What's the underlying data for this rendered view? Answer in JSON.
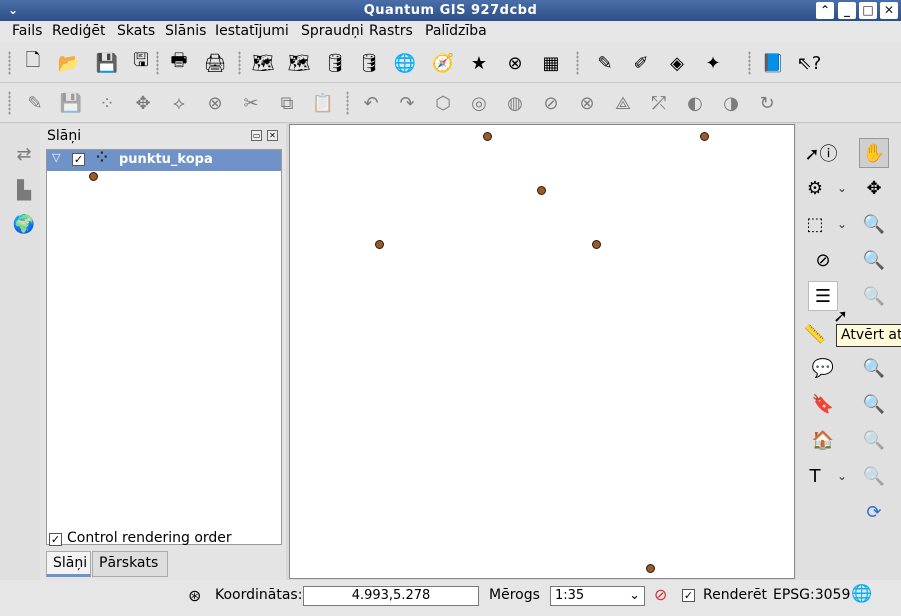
{
  "window": {
    "title": "Quantum GIS 927dcbd"
  },
  "menubar": {
    "items": [
      "Fails",
      "Rediģēt",
      "Skats",
      "Slānis",
      "Iestatījumi",
      "Spraudņi",
      "Rastrs",
      "Palīdzība"
    ]
  },
  "toolbar1": {
    "icons": [
      "new-project",
      "open-project",
      "save-project",
      "save-as",
      "print-composer",
      "print",
      "add-vector-layer",
      "add-raster-layer",
      "add-postgis-layer",
      "add-spatialite-layer",
      "add-wms-layer",
      "add-wfs-layer",
      "new-vector-layer",
      "remove-layer",
      "new-shapefile",
      "spellcheck",
      "label-tool",
      "annotation-tool",
      "plugin-tool",
      "help",
      "whats-this"
    ]
  },
  "toolbar2": {
    "icons": [
      "edit-pencil",
      "save-edits",
      "add-feature",
      "move-feature",
      "node-tool",
      "delete-selected",
      "cut-features",
      "copy-features",
      "paste-features",
      "undo",
      "redo",
      "simplify",
      "add-ring",
      "add-part",
      "delete-ring",
      "delete-part",
      "reshape",
      "split",
      "merge",
      "rotate",
      "redo-arrow"
    ]
  },
  "layers_panel": {
    "title": "Slāņi",
    "layers": [
      {
        "name": "punktu_kopa",
        "checked": true,
        "expanded": true,
        "symbol_color": "#9a5a2c"
      }
    ],
    "control_rendering_order": {
      "label": "Control rendering order",
      "checked": true
    },
    "tabs": [
      "Slāņi",
      "Pārskats"
    ],
    "active_tab": "Slāņi"
  },
  "map_canvas": {
    "point_color": "#9a5a2c",
    "points": [
      {
        "id": 1
      },
      {
        "id": 2
      },
      {
        "id": 3
      },
      {
        "id": 4
      },
      {
        "id": 5
      },
      {
        "id": 6
      }
    ]
  },
  "right_panel": {
    "icons": [
      "identify",
      "pan",
      "action",
      "zoom-full",
      "select",
      "zoom-in",
      "deselect",
      "zoom-out",
      "attribute-table",
      "zoom-last",
      "measure",
      "zoom-layer",
      "map-tips",
      "zoom-selection",
      "new-bookmark",
      "zoom-actual",
      "show-bookmarks",
      "zoom-next",
      "text-annotation",
      "zoom-back",
      "refresh"
    ]
  },
  "tooltip": {
    "text": "Atvērt at"
  },
  "statusbar": {
    "coordinates_label": "Koordinātas:",
    "coordinates_value": "4.993,5.278",
    "scale_label": "Mērogs",
    "scale_value": "1:35",
    "render_label": "Renderēt",
    "render_checked": true,
    "crs": "EPSG:3059"
  },
  "colors": {
    "title_bar": "#2c4f8a",
    "selection": "#6f93c8"
  }
}
